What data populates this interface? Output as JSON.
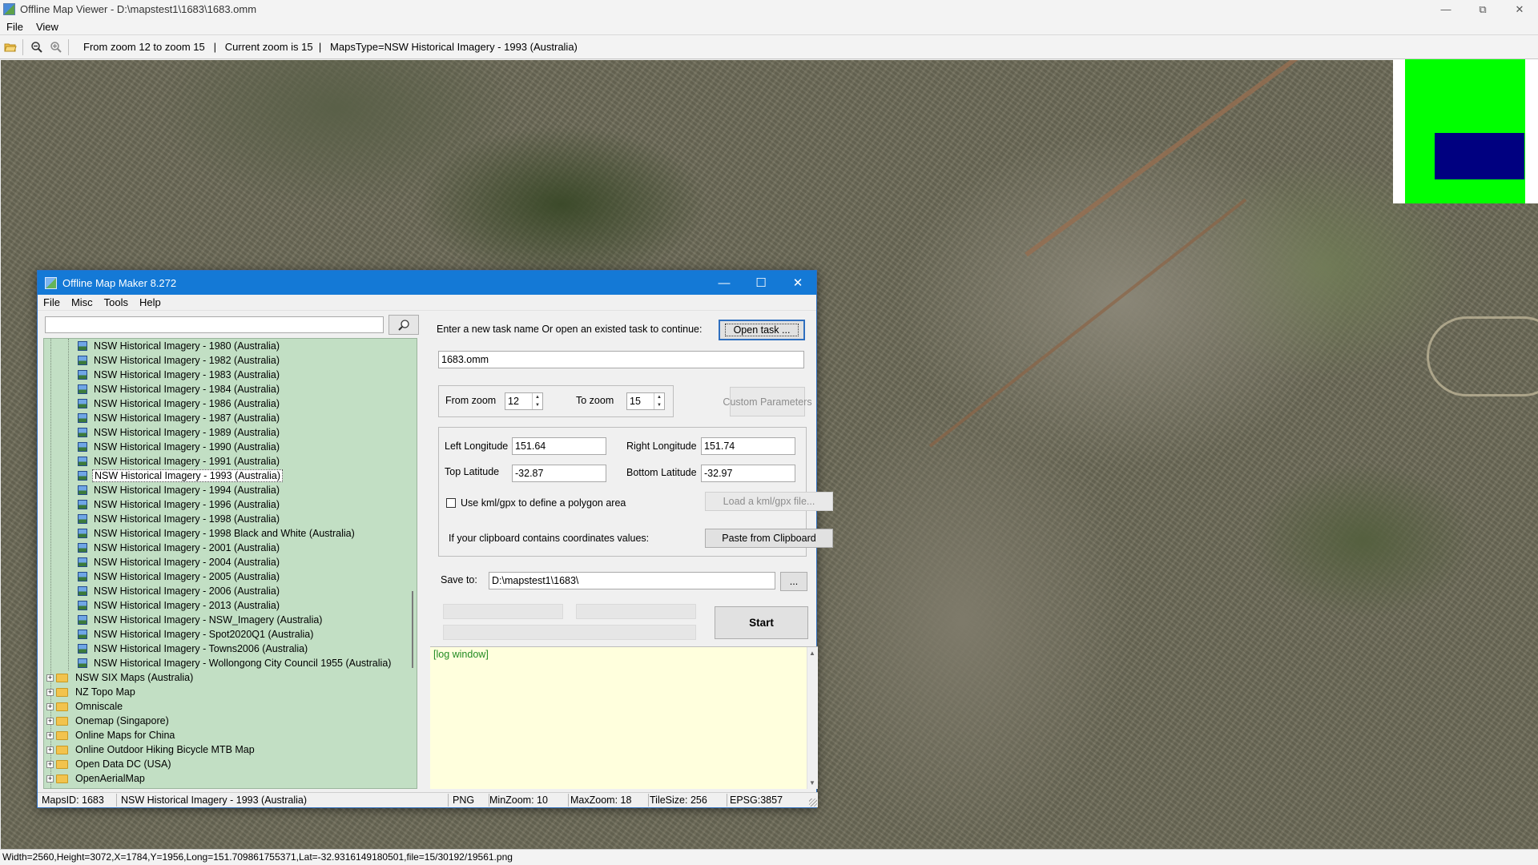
{
  "window": {
    "title": "Offline Map Viewer - D:\\mapstest1\\1683\\1683.omm",
    "controls": [
      "minimize",
      "restore",
      "close"
    ]
  },
  "menubar": [
    "File",
    "View"
  ],
  "toolbar": {
    "info": "From zoom 12 to zoom 15   |   Current zoom is 15  |   MapsType=NSW Historical Imagery - 1993 (Australia)"
  },
  "statusbar": {
    "text": "Width=2560,Height=3072,X=1784,Y=1956,Long=151.709861755371,Lat=-32.9316149180501,file=15/30192/19561.png"
  },
  "colors": {
    "accent": "#1479d6",
    "tree_bg": "#c2dfc4",
    "log_bg": "#ffffdd",
    "minimap_green": "#00ff00",
    "minimap_blue": "#000080"
  },
  "dialog": {
    "title": "Offline Map Maker 8.272",
    "menu": [
      "File",
      "Misc",
      "Tools",
      "Help"
    ],
    "search": {
      "value": "",
      "placeholder": ""
    },
    "tree": {
      "leaves": [
        "NSW Historical Imagery - 1980 (Australia)",
        "NSW Historical Imagery - 1982 (Australia)",
        "NSW Historical Imagery - 1983 (Australia)",
        "NSW Historical Imagery - 1984 (Australia)",
        "NSW Historical Imagery - 1986 (Australia)",
        "NSW Historical Imagery - 1987 (Australia)",
        "NSW Historical Imagery - 1989 (Australia)",
        "NSW Historical Imagery - 1990 (Australia)",
        "NSW Historical Imagery - 1991 (Australia)",
        "NSW Historical Imagery - 1993 (Australia)",
        "NSW Historical Imagery - 1994 (Australia)",
        "NSW Historical Imagery - 1996 (Australia)",
        "NSW Historical Imagery - 1998 (Australia)",
        "NSW Historical Imagery - 1998 Black and White (Australia)",
        "NSW Historical Imagery - 2001 (Australia)",
        "NSW Historical Imagery - 2004 (Australia)",
        "NSW Historical Imagery - 2005 (Australia)",
        "NSW Historical Imagery - 2006 (Australia)",
        "NSW Historical Imagery - 2013 (Australia)",
        "NSW Historical Imagery - NSW_Imagery (Australia)",
        "NSW Historical Imagery - Spot2020Q1 (Australia)",
        "NSW Historical Imagery - Towns2006 (Australia)",
        "NSW Historical Imagery - Wollongong City Council 1955 (Australia)"
      ],
      "selected": "NSW Historical Imagery - 1993 (Australia)",
      "folders": [
        "NSW SIX Maps (Australia)",
        "NZ Topo Map",
        "Omniscale",
        "Onemap (Singapore)",
        "Online Maps for China",
        "Online Outdoor Hiking Bicycle MTB Map",
        "Open Data DC (USA)",
        "OpenAerialMap"
      ]
    },
    "task_prompt": "Enter a new task name Or open an existed task to continue:",
    "open_task_label": "Open task ...",
    "task_name": "1683.omm",
    "from_zoom_label": "From zoom",
    "from_zoom": "12",
    "to_zoom_label": "To zoom",
    "to_zoom": "15",
    "custom_params_label": "Custom Parameters",
    "left_lon_label": "Left Longitude",
    "left_lon": "151.64",
    "right_lon_label": "Right Longitude",
    "right_lon": "151.74",
    "top_lat_label": "Top Latitude",
    "top_lat": "-32.87",
    "bottom_lat_label": "Bottom Latitude",
    "bottom_lat": "-32.97",
    "kml_label": "Use kml/gpx to define a polygon area",
    "kml_checked": false,
    "load_kml_label": "Load a kml/gpx file...",
    "clipboard_prompt": "If your clipboard contains coordinates values:",
    "paste_label": "Paste from Clipboard",
    "save_to_label": "Save to:",
    "save_to": "D:\\mapstest1\\1683\\",
    "browse_label": "...",
    "start_label": "Start",
    "log_text": "[log window]",
    "status": {
      "mapsid": "MapsID: 1683",
      "mapname": "NSW Historical Imagery - 1993 (Australia)",
      "format": "PNG",
      "minzoom": "MinZoom: 10",
      "maxzoom": "MaxZoom: 18",
      "tilesize": "TileSize: 256",
      "epsg": "EPSG:3857"
    }
  }
}
